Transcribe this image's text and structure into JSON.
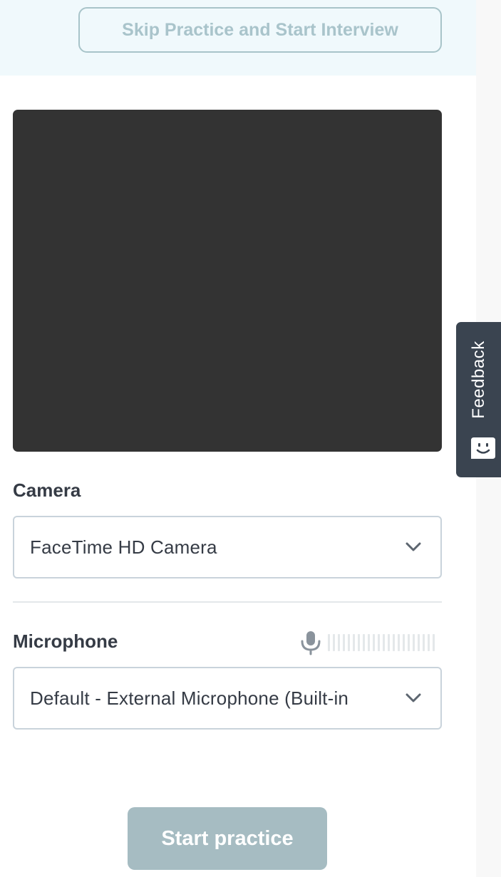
{
  "header": {
    "skip_button_label": "Skip Practice and Start Interview"
  },
  "camera": {
    "label": "Camera",
    "selected": "FaceTime HD Camera",
    "chevron_icon": "chevron-down-icon"
  },
  "microphone": {
    "label": "Microphone",
    "selected": "Default - External Microphone (Built-in",
    "chevron_icon": "chevron-down-icon",
    "level_icon": "microphone-icon",
    "level_fraction": 0
  },
  "actions": {
    "start_label": "Start practice"
  },
  "feedback": {
    "label": "Feedback",
    "icon": "smiley-face-icon"
  },
  "colors": {
    "banner_bg": "#f0f9fc",
    "video_bg": "#333333",
    "text_primary": "#353b45",
    "button_disabled_bg": "#a6bcc2",
    "skip_button_text": "#a9c4cb",
    "feedback_bg": "#3a4450"
  }
}
